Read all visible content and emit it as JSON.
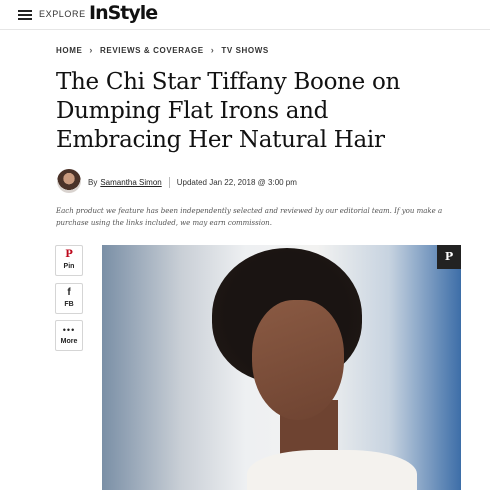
{
  "header": {
    "explore_label": "EXPLORE",
    "logo_text": "InStyle"
  },
  "breadcrumb": {
    "items": [
      "HOME",
      "REVIEWS & COVERAGE",
      "TV SHOWS"
    ],
    "separator": "›"
  },
  "article": {
    "title": "The Chi Star Tiffany Boone on Dumping Flat Irons and Embracing Her Natural Hair",
    "by_label": "By",
    "author": "Samantha Simon",
    "updated": "Updated Jan 22, 2018 @ 3:00 pm",
    "disclaimer": "Each product we feature has been independently selected and reviewed by our editorial team. If you make a purchase using the links included, we may earn commission."
  },
  "share": {
    "pin": {
      "icon": "pinterest-icon",
      "glyph": "P",
      "label": "Pin"
    },
    "fb": {
      "icon": "facebook-icon",
      "glyph": "f",
      "label": "FB"
    },
    "more": {
      "icon": "more-icon",
      "glyph": "•••",
      "label": "More"
    }
  },
  "photo_pin": {
    "icon": "pinterest-icon",
    "glyph": "P"
  },
  "colors": {
    "pinterest_red": "#bd081c",
    "text": "#111111"
  }
}
